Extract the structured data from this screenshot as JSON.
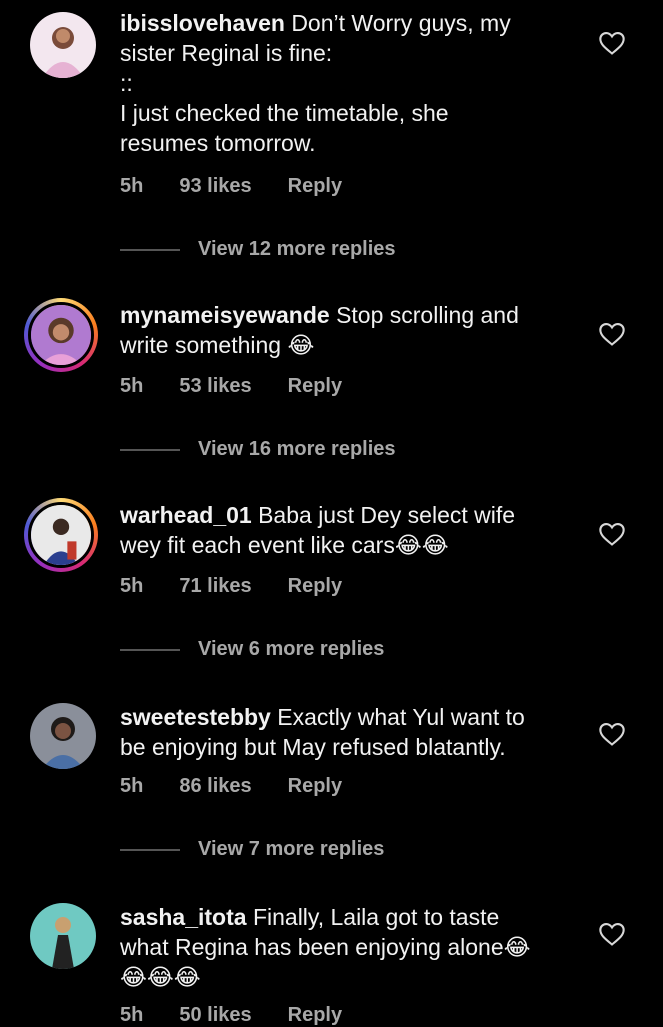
{
  "comments": [
    {
      "username": "ibisslovehaven",
      "text": "Don’t Worry guys, my\nsister Reginal is fine:\n::\nI just checked the timetable, she\nresumes tomorrow.",
      "time": "5h",
      "likes": "93 likes",
      "reply": "Reply",
      "view_replies": "View 12 more replies"
    },
    {
      "username": "mynameisyewande",
      "text": "Stop scrolling and\nwrite something 😂",
      "time": "5h",
      "likes": "53 likes",
      "reply": "Reply",
      "view_replies": "View 16 more replies"
    },
    {
      "username": "warhead_01",
      "text": "Baba just Dey select wife\nwey fit each event like cars😂😂",
      "time": "5h",
      "likes": "71 likes",
      "reply": "Reply",
      "view_replies": "View 6 more replies"
    },
    {
      "username": "sweetestebby",
      "text": "Exactly what Yul want to\nbe enjoying but May refused blatantly.",
      "time": "5h",
      "likes": "86 likes",
      "reply": "Reply",
      "view_replies": "View 7 more replies"
    },
    {
      "username": "sasha_itota",
      "text": "Finally, Laila got to taste\nwhat Regina has been enjoying alone😂\n😂😂😂",
      "time": "5h",
      "likes": "50 likes",
      "reply": "Reply"
    }
  ],
  "colors": {
    "background": "#000000",
    "text": "#f2f2f2",
    "muted": "#a8a8a8",
    "story_ring": [
      "#feda75",
      "#fa7e1e",
      "#d62976",
      "#962fbf",
      "#4f5bd5"
    ]
  },
  "icons": {
    "like": "heart-outline-icon"
  }
}
